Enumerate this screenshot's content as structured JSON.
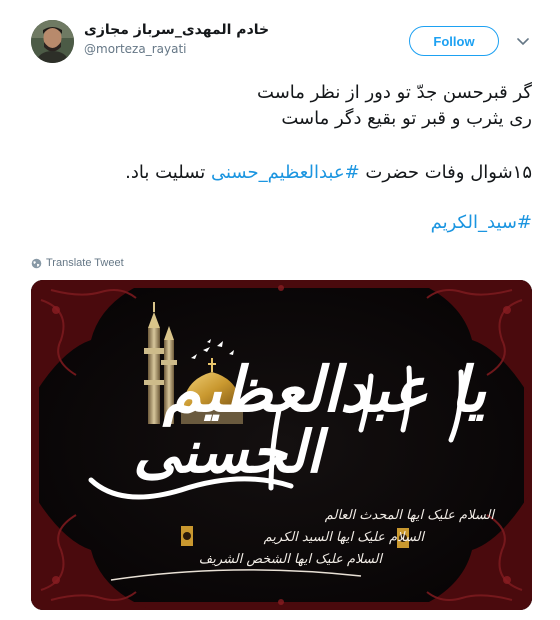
{
  "user": {
    "display_name": "خادم المهدی_سرباز مجازی",
    "username": "@morteza_rayati",
    "avatar_icon": "user-avatar-photo"
  },
  "header": {
    "follow_label": "Follow",
    "menu_icon": "chevron-down-icon"
  },
  "tweet": {
    "line1": "گر قبرحسن جدّ تو دور از نظر ماست",
    "line2": "ری یثرب و قبر تو بقیع دگر ماست",
    "line3_prefix": "۱۵شوال وفات حضرت",
    "line3_hashtag": "#عبدالعظیم_حسنی",
    "line3_suffix": "تسلیت باد.",
    "hashtag2": "#سید_الکریم"
  },
  "translate_label": "Translate Tweet",
  "image": {
    "title_line1": "یا عبدالعظیم",
    "title_line2": "الحسنی",
    "salam_1": "السلام علیک ایها المحدث العالم",
    "salam_2": "السلام علیک ایها السید الکریم",
    "salam_3": "السلام علیک ایها الشخص الشریف"
  },
  "colors": {
    "link": "#1b95e0",
    "follow": "#1da1f2",
    "muted": "#657786",
    "frame_red": "#5a0d10",
    "dome_gold": "#c9982f"
  }
}
